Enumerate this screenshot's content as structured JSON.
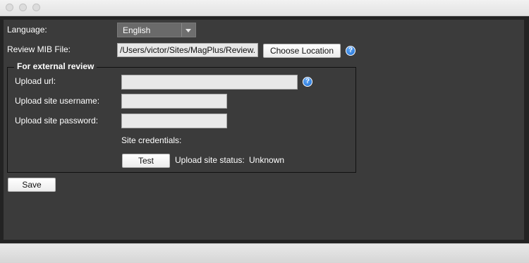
{
  "window": {
    "controls": [
      "close",
      "minimize",
      "zoom"
    ]
  },
  "language": {
    "label": "Language:",
    "selected": "English"
  },
  "review_mib": {
    "label": "Review MIB File:",
    "path_value": "/Users/victor/Sites/MagPlus/Review.m",
    "choose_button": "Choose Location",
    "help_icon": "help-icon"
  },
  "external_review": {
    "legend": "For external review",
    "upload_url_label": "Upload url:",
    "upload_url_value": "",
    "username_label": "Upload site username:",
    "username_value": "",
    "password_label": "Upload site password:",
    "password_value": "",
    "credentials_label": "Site credentials:",
    "test_button": "Test",
    "status_label": "Upload site status:",
    "status_value": "Unknown"
  },
  "actions": {
    "save_button": "Save"
  },
  "colors": {
    "panel_bg": "#3b3b3b",
    "outer_bg": "#232323",
    "help_blue": "#1e6fd4"
  }
}
